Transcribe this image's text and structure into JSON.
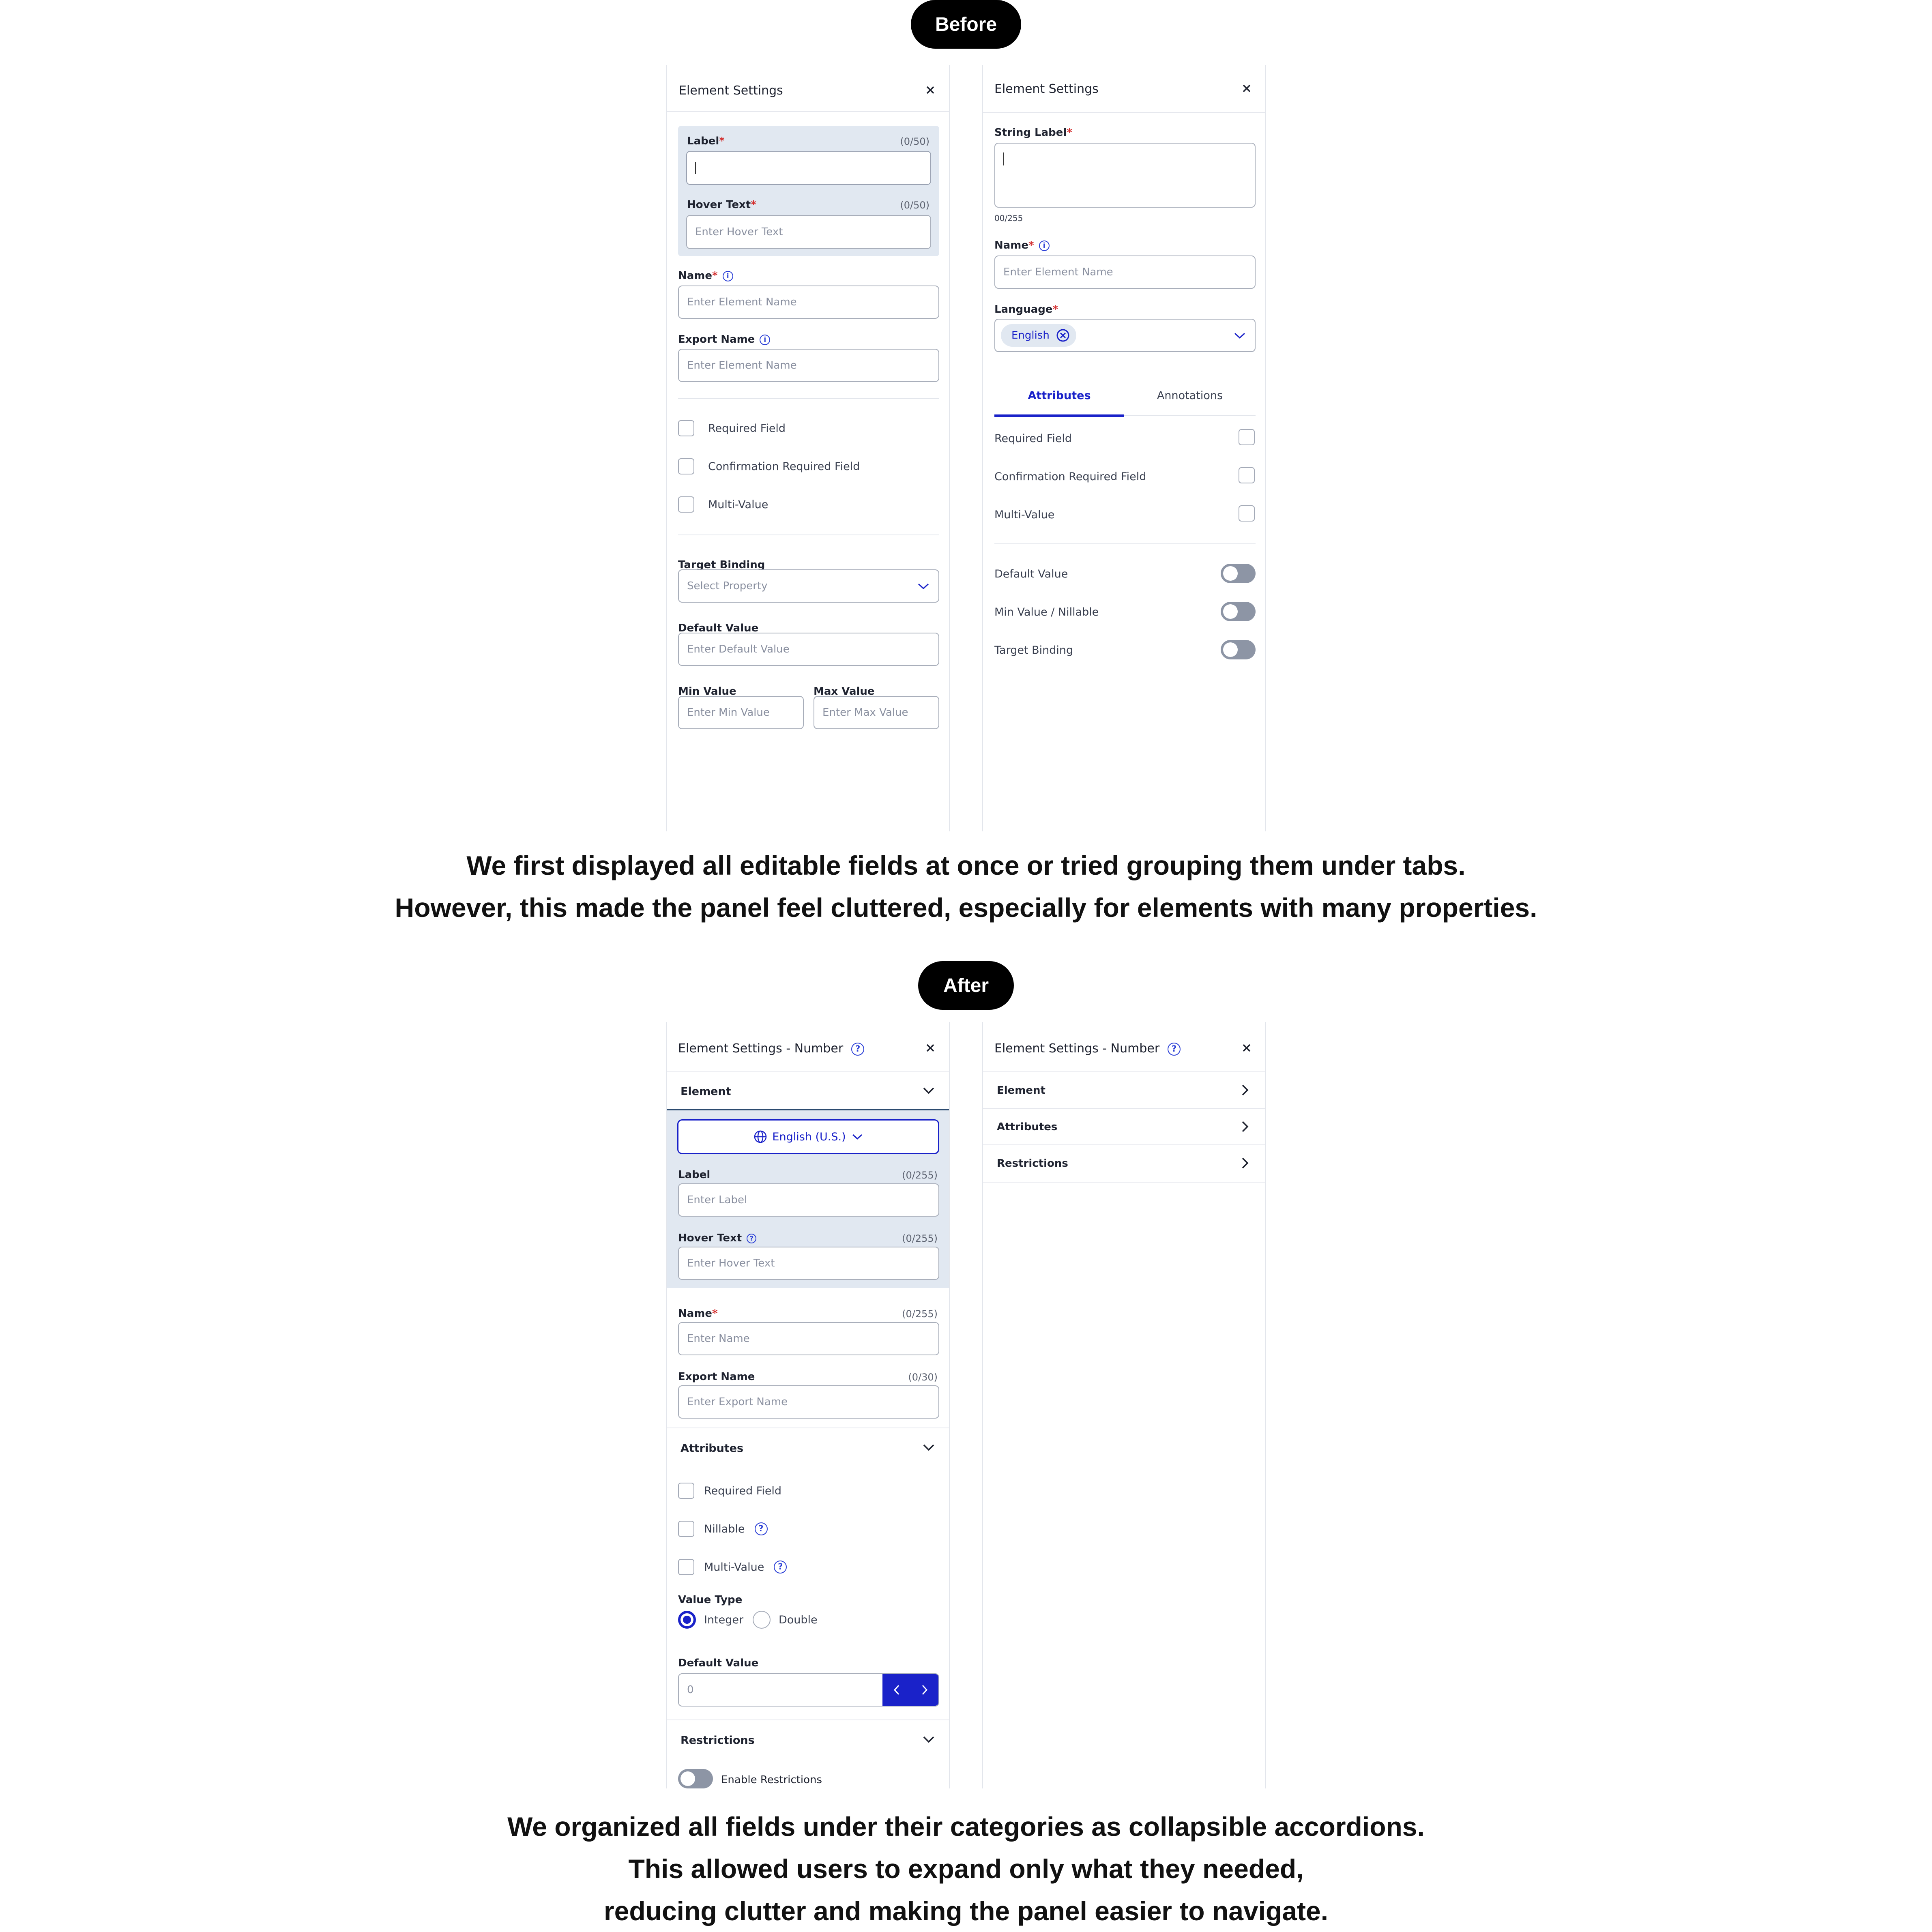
{
  "before": {
    "pill": "Before",
    "left_panel": {
      "title": "Element Settings",
      "label": {
        "label": "Label",
        "counter": "(0/50)"
      },
      "hover_text": {
        "label": "Hover Text",
        "counter": "(0/50)",
        "placeholder": "Enter Hover Text"
      },
      "name": {
        "label": "Name",
        "placeholder": "Enter Element Name"
      },
      "export_name": {
        "label": "Export Name",
        "placeholder": "Enter Element Name"
      },
      "checkboxes": [
        "Required Field",
        "Confirmation Required Field",
        "Multi-Value"
      ],
      "target_binding": {
        "label": "Target Binding",
        "placeholder": "Select Property"
      },
      "default_value": {
        "label": "Default Value",
        "placeholder": "Enter Default Value"
      },
      "min_value": {
        "label": "Min Value",
        "placeholder": "Enter Min Value"
      },
      "max_value": {
        "label": "Max Value",
        "placeholder": "Enter Max Value"
      }
    },
    "right_panel": {
      "title": "Element Settings",
      "string_label": {
        "label": "String Label",
        "counter": "00/255"
      },
      "name": {
        "label": "Name",
        "placeholder": "Enter Element Name"
      },
      "language": {
        "label": "Language",
        "chip": "English"
      },
      "tabs": [
        "Attributes",
        "Annotations"
      ],
      "checkboxes": [
        "Required Field",
        "Confirmation Required Field",
        "Multi-Value"
      ],
      "toggles": [
        "Default Value",
        "Min Value / Nillable",
        "Target Binding"
      ]
    }
  },
  "caption_before": [
    "We first displayed all editable fields at once or tried grouping them under tabs.",
    "However, this made the panel feel cluttered, especially for elements with many properties."
  ],
  "after": {
    "pill": "After",
    "left_panel": {
      "title": "Element Settings - Number",
      "sections": {
        "element": "Element",
        "attributes": "Attributes",
        "restrictions": "Restrictions"
      },
      "language_button": "English (U.S.)",
      "label": {
        "label": "Label",
        "counter": "(0/255)",
        "placeholder": "Enter Label"
      },
      "hover_text": {
        "label": "Hover Text",
        "counter": "(0/255)",
        "placeholder": "Enter Hover Text"
      },
      "name": {
        "label": "Name",
        "counter": "(0/255)",
        "placeholder": "Enter Name"
      },
      "export_name": {
        "label": "Export Name",
        "counter": "(0/30)",
        "placeholder": "Enter Export Name"
      },
      "checkboxes": [
        "Required Field",
        "Nillable",
        "Multi-Value"
      ],
      "value_type": {
        "label": "Value Type",
        "options": [
          "Integer",
          "Double"
        ],
        "selected": "Integer"
      },
      "default_value": {
        "label": "Default Value",
        "value": "0"
      },
      "enable_restrictions": "Enable Restrictions"
    },
    "right_panel": {
      "title": "Element Settings - Number",
      "rows": [
        "Element",
        "Attributes",
        "Restrictions"
      ]
    }
  },
  "caption_after": [
    "We organized all fields under their categories as collapsible accordions.",
    "This allowed users to expand only what they needed,",
    "reducing clutter and making the panel easier to navigate."
  ],
  "colors": {
    "accent": "#1a22c9",
    "highlight_bg": "#e1e8f1",
    "toggle_off": "#8d95a5",
    "required": "#d32f2f"
  }
}
